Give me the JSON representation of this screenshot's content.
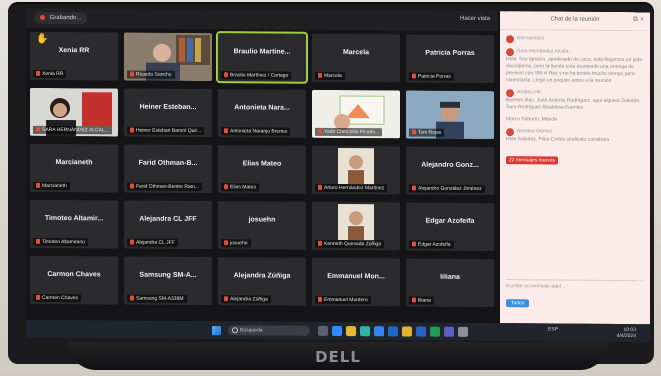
{
  "zoom": {
    "recording_label": "Grabando...",
    "view_label": "Hacer vista",
    "tiles": [
      {
        "name": "Xenia RR",
        "label": "Xenia RR",
        "hand": true
      },
      {
        "name": "",
        "label": "Ricardo Sancho",
        "video": "man-office"
      },
      {
        "name": "Braulio Martine...",
        "label": "Braulio Martínez / Cartago",
        "active": true
      },
      {
        "name": "Marcela",
        "label": "Marcela"
      },
      {
        "name": "Patricia Porras",
        "label": "Patricia Porras"
      },
      {
        "name": "",
        "label": "SARA HERNÁNDEZ ALCAL...",
        "video": "woman-red"
      },
      {
        "name": "Heiner Esteban...",
        "label": "Heiner Esteban Baroni Quir..."
      },
      {
        "name": "Antonieta Nara...",
        "label": "Antonieta Naranjo Brenes"
      },
      {
        "name": "",
        "label": "Yadir Chinchilla Picado...",
        "video": "screen"
      },
      {
        "name": "",
        "label": "Toni Rojas",
        "video": "man-cap"
      },
      {
        "name": "Marcianeth",
        "label": "Marcianeth"
      },
      {
        "name": "Farid Othman-B...",
        "label": "Farid Othman-Bentre Ram..."
      },
      {
        "name": "Elias Mateo",
        "label": "Elias Mateo"
      },
      {
        "name": "",
        "label": "Arturo Hernández Martínez",
        "video": "tiny-person"
      },
      {
        "name": "Alejandro Gonz...",
        "label": "Alejandro González Jiménez"
      },
      {
        "name": "Timoteo Altamir...",
        "label": "Timoteo Altamirano"
      },
      {
        "name": "Alejandra CL JFF",
        "label": "Alejandra CL JFF"
      },
      {
        "name": "josuehn",
        "label": "josuehn"
      },
      {
        "name": "",
        "label": "Kenneth Quesada Zúñiga",
        "video": "tiny-person"
      },
      {
        "name": "Edgar Azofeifa",
        "label": "Edgar Azofeifa"
      },
      {
        "name": "Carmon Chaves",
        "label": "Carmen Chaves"
      },
      {
        "name": "Samsung SM-A...",
        "label": "Samsung SM-A336M"
      },
      {
        "name": "Alejandra Zúñiga",
        "label": "Alejandra Zúñiga"
      },
      {
        "name": "Emmanuel Mon...",
        "label": "Emmanuel Montero"
      },
      {
        "name": "liliana",
        "label": "liliana"
      }
    ]
  },
  "chat": {
    "title": "Chat de la reunión",
    "messages": [
      {
        "from": "Bienvenidos",
        "body": ""
      },
      {
        "from": "Sara Hernández Alcalá...",
        "body": "Hola. Soy Ignacio, apoderado de caco, esta llegamos un pide discúlpeme, pero la tienda esta reuniendo una entrega de premios con SM el Rey y no ha tenido mucho tiempo para conectarse. Llegó un poquito antes a la reunión"
      },
      {
        "from": "Andrés HK:",
        "body": "Buenos días. Juan Antonio Rodríguez, aqui alguien Zeledón. Sara Rodríguez Alcaldesa Fuentes"
      },
      {
        "from": "",
        "body": "Marco Saborío, Mérida"
      },
      {
        "from": "Nombre Gómez",
        "body": "Hola Saludos. Flica Cortés sindicato carrabrea"
      }
    ],
    "tag": "22 mensajes nuevos",
    "input_placeholder": "Escribe un mensaje aquí...",
    "send_label": "Todos"
  },
  "taskbar": {
    "search_placeholder": "Búsqueda",
    "lang": "ESP",
    "time": "10:03",
    "date": "4/4/2024"
  },
  "photo": {
    "brand": "DELL"
  }
}
